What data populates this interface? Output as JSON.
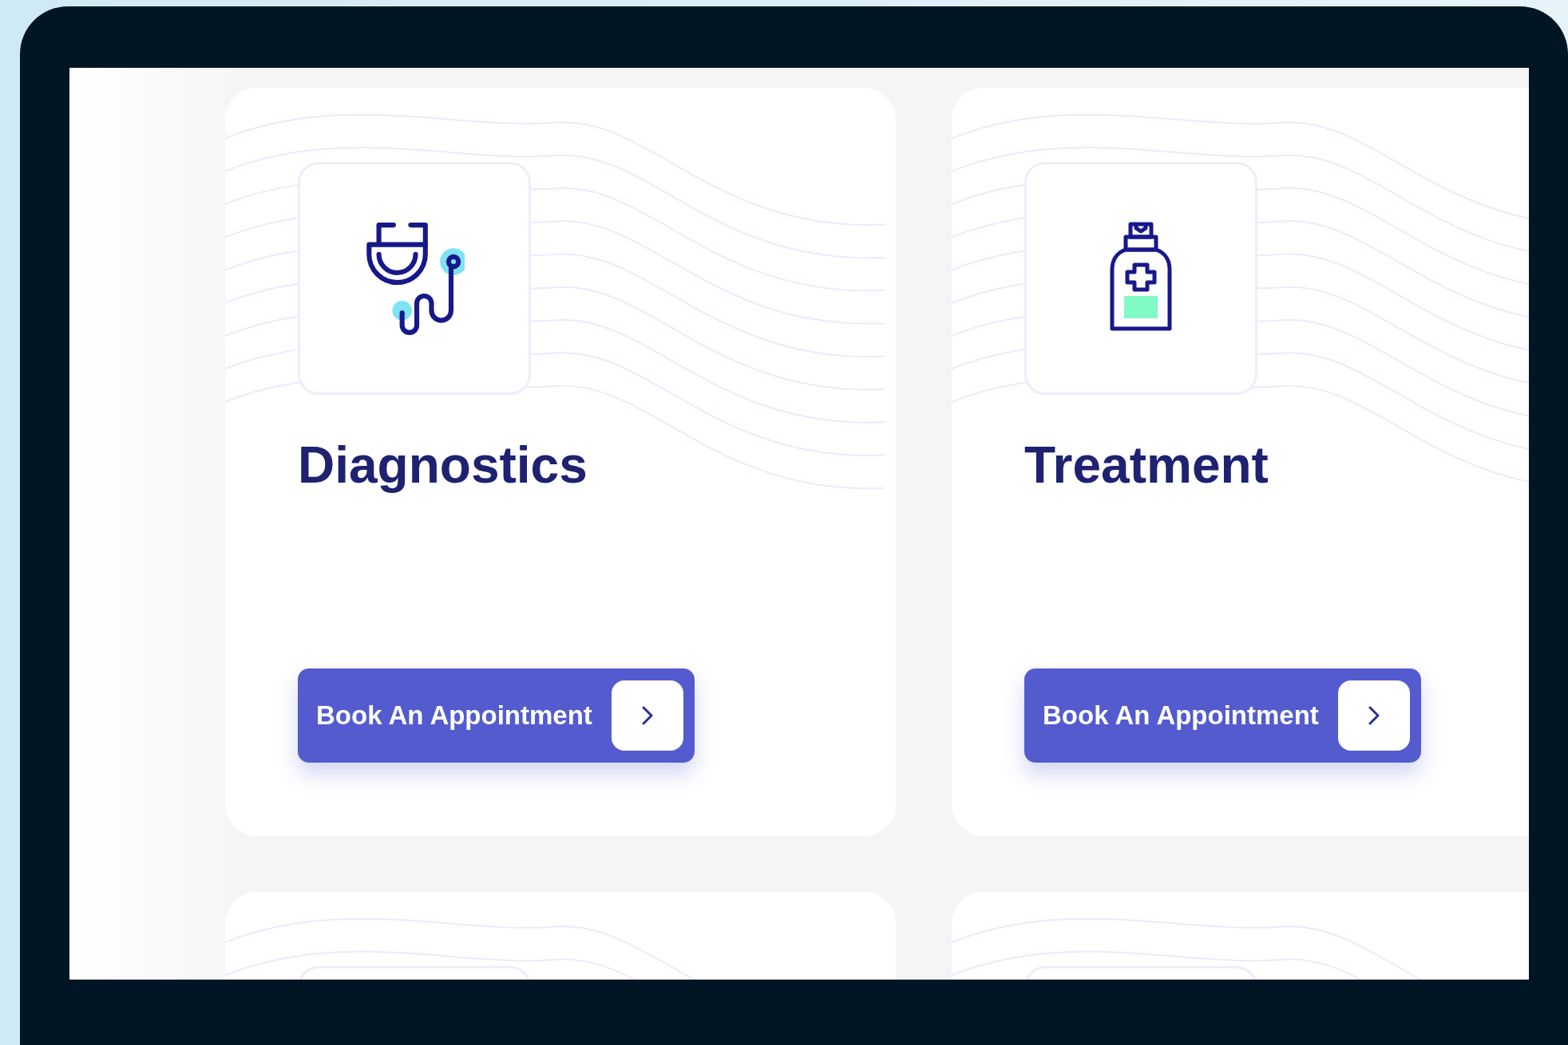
{
  "cards": [
    {
      "kind": "full",
      "title": "Diagnostics",
      "button": {
        "label": "Book An Appointment"
      }
    },
    {
      "kind": "full",
      "title": "Treatment",
      "button": {
        "label": "Book An Appointment"
      }
    },
    {
      "kind": "cut"
    },
    {
      "kind": "cut"
    }
  ]
}
